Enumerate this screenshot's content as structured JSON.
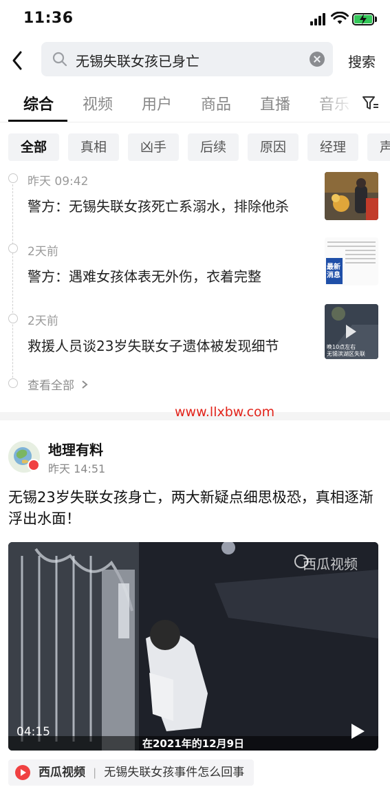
{
  "status_bar": {
    "time": "11:36"
  },
  "search": {
    "query": "无锡失联女孩已身亡",
    "submit_label": "搜索"
  },
  "tabs": [
    "综合",
    "视频",
    "用户",
    "商品",
    "直播",
    "音乐"
  ],
  "chips": [
    "全部",
    "真相",
    "凶手",
    "后续",
    "原因",
    "经理",
    "声"
  ],
  "timeline": {
    "items": [
      {
        "time": "昨天 09:42",
        "title": "警方：无锡失联女孩死亡系溺水，排除他杀"
      },
      {
        "time": "2天前",
        "title": "警方：遇难女孩体表无外伤，衣着完整"
      },
      {
        "time": "2天前",
        "title": "救援人员谈23岁失联女子遗体被发现细节"
      }
    ],
    "see_all": "查看全部"
  },
  "watermark": "www.llxbw.com",
  "post": {
    "author": "地理有料",
    "time": "昨天 14:51",
    "text": "无锡23岁失联女孩身亡，两大新疑点细思极恐，真相逐渐浮出水面！",
    "video": {
      "logo": "西瓜视频",
      "duration": "04:15",
      "caption": "在2021年的12月9日"
    },
    "source": {
      "name": "西瓜视频",
      "separator": "|",
      "title": "无锡失联女孩事件怎么回事"
    }
  },
  "thumb_texts": {
    "thumb2": "最新\n消息",
    "thumb3": "晚10点左右\n无锡滨湖区失联"
  },
  "colors": {
    "accent_red": "#f04142",
    "battery_green": "#34c759"
  }
}
